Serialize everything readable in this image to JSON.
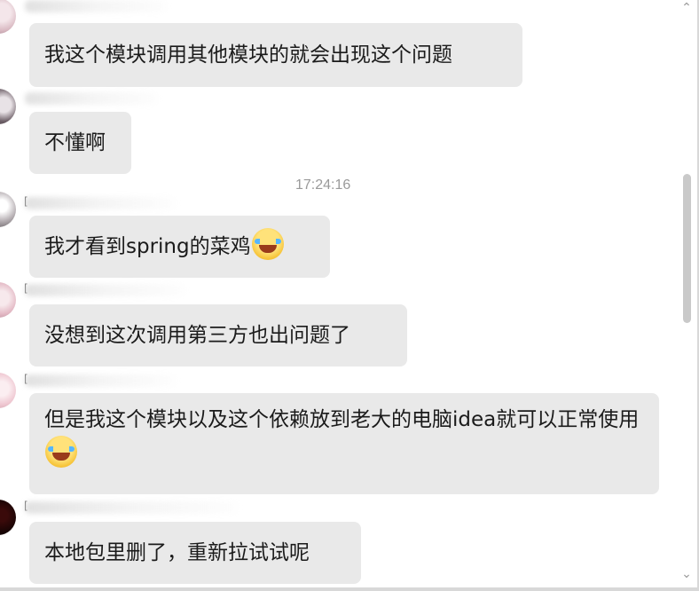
{
  "chat": {
    "timestamp": "17:24:16",
    "messages": [
      {
        "text": "我这个模块调用其他模块的就会出现这个问题"
      },
      {
        "text": "不懂啊"
      },
      {
        "text": "我才看到spring的菜鸡",
        "emoji": "laughing-crying-emoji"
      },
      {
        "text": "没想到这次调用第三方也出问题了"
      },
      {
        "text": "但是我这个模块以及这个依赖放到老大的电脑idea就可以正常使用",
        "emoji": "laughing-crying-emoji"
      },
      {
        "text": "本地包里删了，重新拉试试呢"
      }
    ]
  },
  "scrollbar": {
    "up_icon": "chevron-up-icon",
    "down_icon": "chevron-down-icon"
  },
  "colors": {
    "bubble": "#e9e9e9",
    "text": "#1b1b1b",
    "timestamp": "#9a9a9a",
    "scroll_thumb": "#c9c9c9"
  }
}
